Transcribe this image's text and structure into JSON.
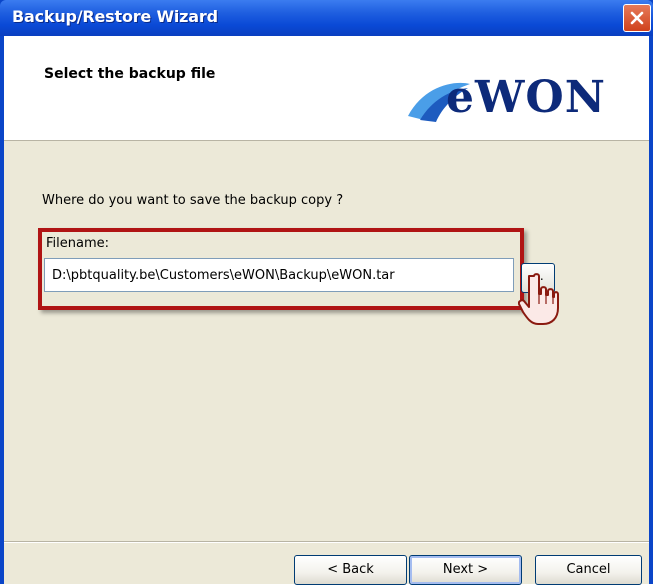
{
  "window": {
    "title": "Backup/Restore Wizard"
  },
  "header": {
    "heading": "Select the backup file",
    "logo_text": "eWON"
  },
  "body": {
    "question": "Where do you want to save the backup copy ?",
    "filename_label": "Filename:",
    "filename_value": "D:\\pbtquality.be\\Customers\\eWON\\Backup\\eWON.tar",
    "browse_label": "..."
  },
  "footer": {
    "back_label": "< Back",
    "next_label": "Next >",
    "cancel_label": "Cancel"
  },
  "colors": {
    "title_bar": "#0a49d6",
    "highlight_border": "#b01414",
    "dialog_bg": "#ece9d8",
    "logo_dark": "#0d2a7a",
    "logo_light": "#4a9ee8"
  }
}
